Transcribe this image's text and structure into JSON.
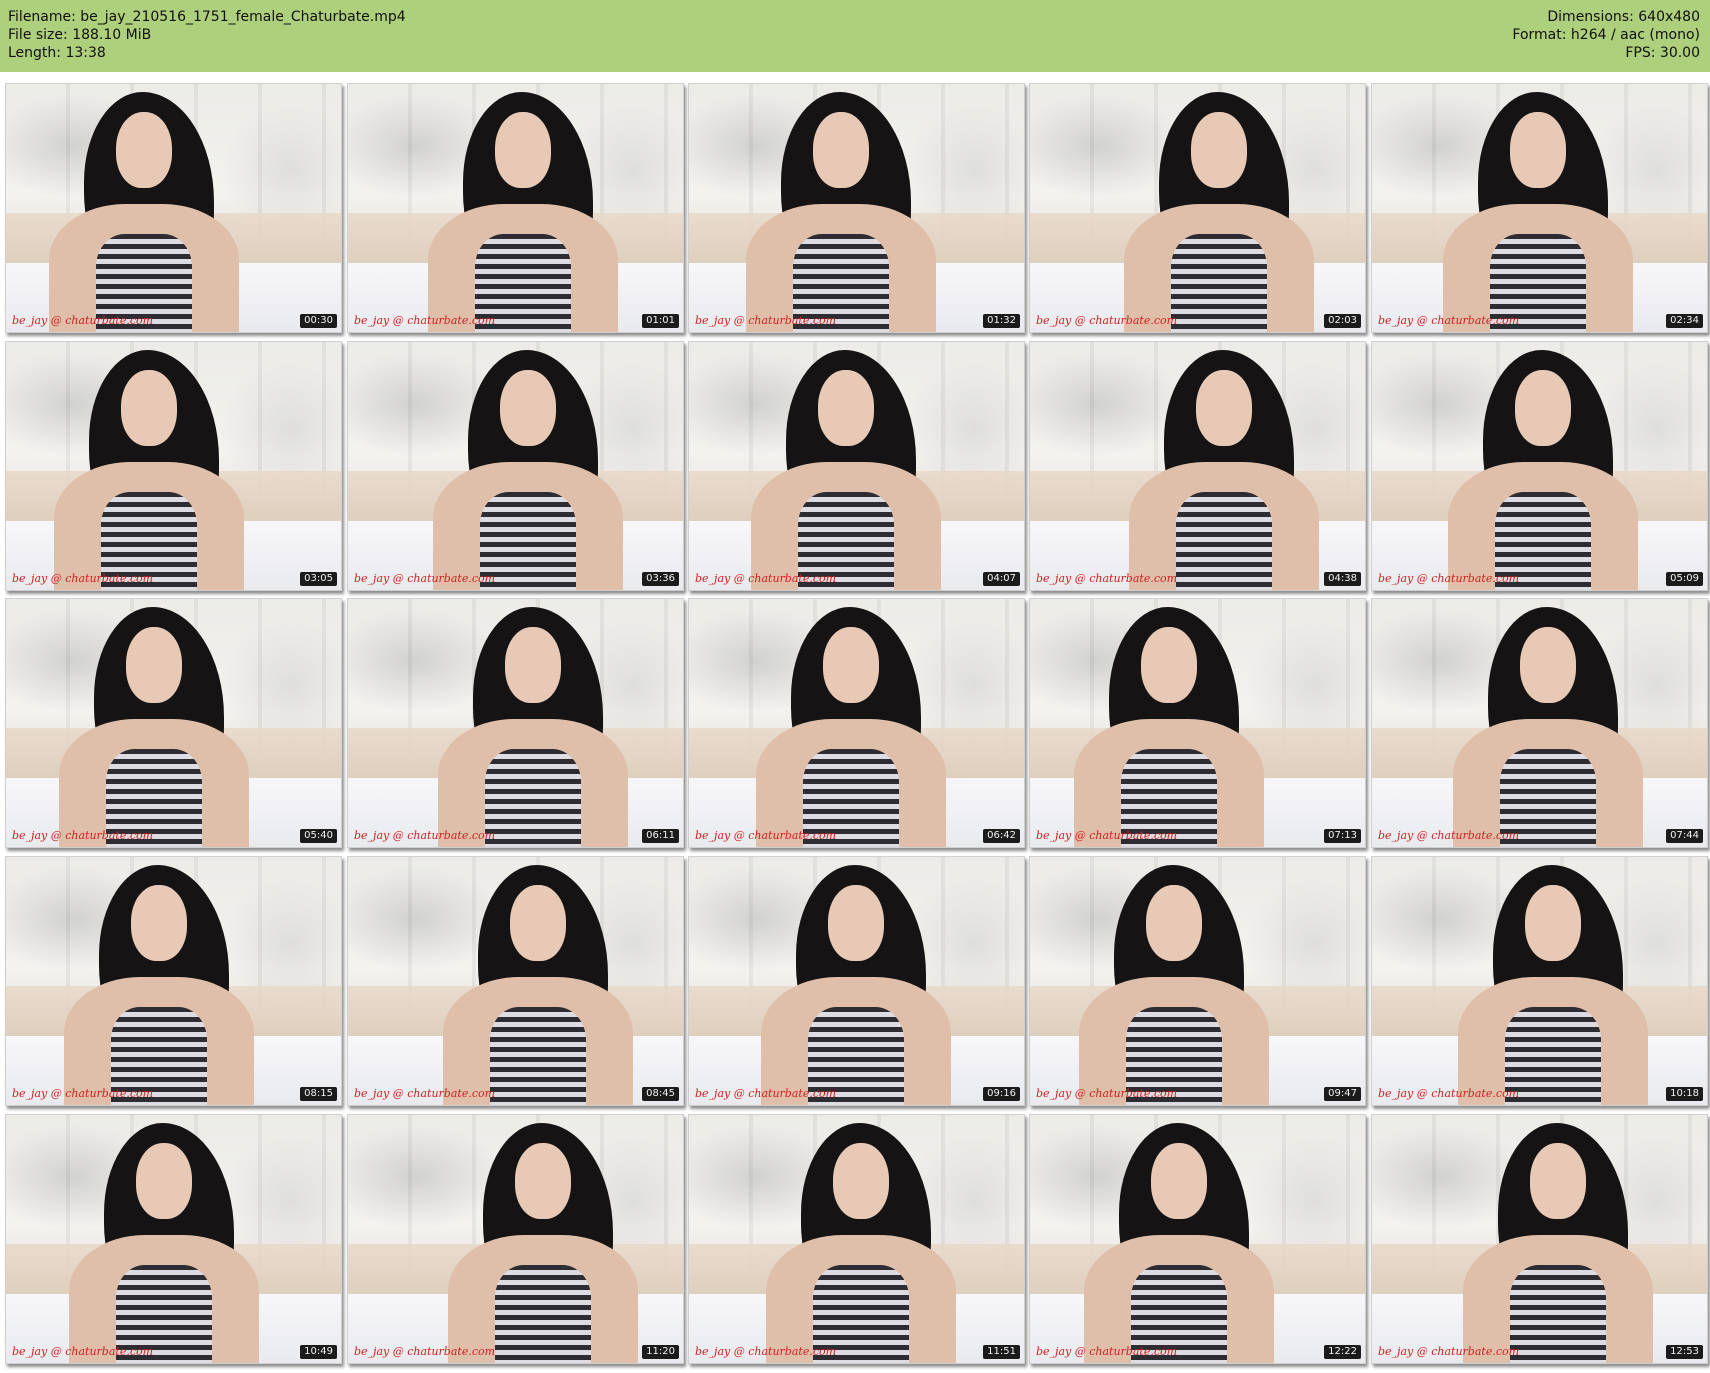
{
  "header": {
    "filename": "Filename: be_jay_210516_1751_female_Chaturbate.mp4",
    "filesize": "File size: 188.10 MiB",
    "length": "Length: 13:38",
    "dimensions": "Dimensions: 640x480",
    "format": "Format: h264 / aac (mono)",
    "fps": "FPS: 30.00"
  },
  "watermark": "be_jay @ chaturbate.com",
  "thumbnails": [
    {
      "time": "00:30"
    },
    {
      "time": "01:01"
    },
    {
      "time": "01:32"
    },
    {
      "time": "02:03"
    },
    {
      "time": "02:34"
    },
    {
      "time": "03:05"
    },
    {
      "time": "03:36"
    },
    {
      "time": "04:07"
    },
    {
      "time": "04:38"
    },
    {
      "time": "05:09"
    },
    {
      "time": "05:40"
    },
    {
      "time": "06:11"
    },
    {
      "time": "06:42"
    },
    {
      "time": "07:13"
    },
    {
      "time": "07:44"
    },
    {
      "time": "08:15"
    },
    {
      "time": "08:45"
    },
    {
      "time": "09:16"
    },
    {
      "time": "09:47"
    },
    {
      "time": "10:18"
    },
    {
      "time": "10:49"
    },
    {
      "time": "11:20"
    },
    {
      "time": "11:51"
    },
    {
      "time": "12:22"
    },
    {
      "time": "12:53"
    }
  ]
}
